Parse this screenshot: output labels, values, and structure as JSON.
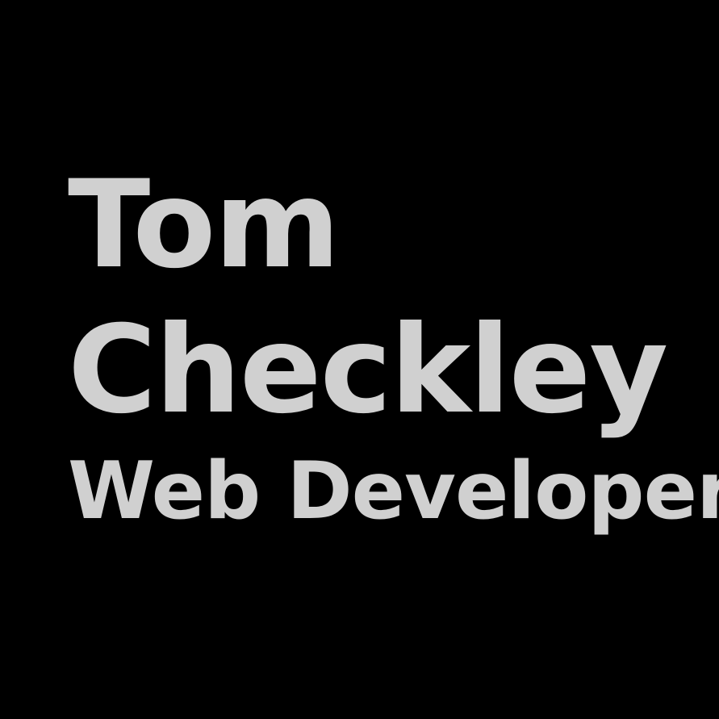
{
  "logo": {
    "first_name": "Tom",
    "last_name": "Checkley",
    "role": "Web Developer",
    "text_color": "#d0d0d0",
    "background_color": "#000000"
  }
}
